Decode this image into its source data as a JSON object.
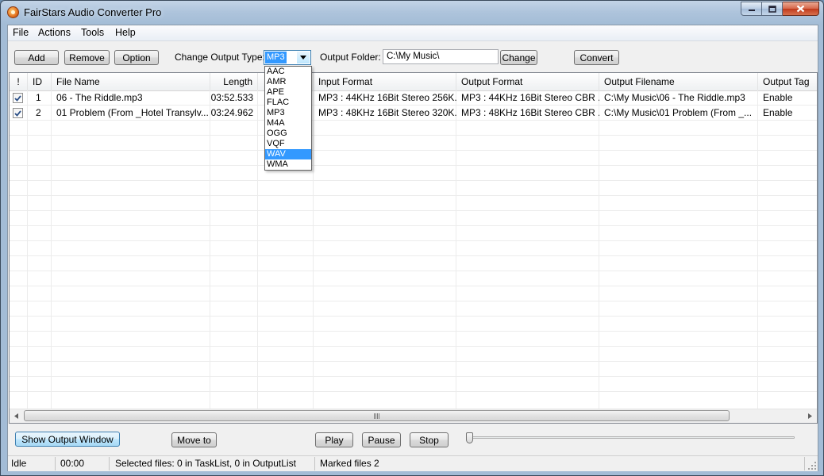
{
  "window": {
    "title": "FairStars Audio Converter Pro"
  },
  "menu": [
    "File",
    "Actions",
    "Tools",
    "Help"
  ],
  "toolbar": {
    "add": "Add",
    "remove": "Remove",
    "option": "Option",
    "output_type_label": "Change Output Type:",
    "output_type_value": "MP3",
    "output_folder_label": "Output Folder:",
    "output_folder_value": "C:\\My Music\\",
    "change": "Change",
    "convert": "Convert"
  },
  "output_type_options": [
    "AAC",
    "AMR",
    "APE",
    "FLAC",
    "MP3",
    "M4A",
    "OGG",
    "VQF",
    "WAV",
    "WMA"
  ],
  "output_type_highlighted": "WAV",
  "table": {
    "columns": [
      "!",
      "ID",
      "File Name",
      "Length",
      "",
      "Input Format",
      "Output Format",
      "Output Filename",
      "Output Tag"
    ],
    "rows": [
      {
        "checked": true,
        "id": "1",
        "file_name": "06 - The Riddle.mp3",
        "length": "03:52.533",
        "size": "",
        "input_format": "MP3 : 44KHz 16Bit Stereo 256K...",
        "output_format": "MP3 : 44KHz 16Bit Stereo CBR ...",
        "output_filename": "C:\\My Music\\06 - The Riddle.mp3",
        "output_tag": "Enable"
      },
      {
        "checked": true,
        "id": "2",
        "file_name": "01 Problem (From _Hotel Transylv...",
        "length": "03:24.962",
        "size": "",
        "input_format": "MP3 : 48KHz 16Bit Stereo 320K...",
        "output_format": "MP3 : 48KHz 16Bit Stereo CBR ...",
        "output_filename": "C:\\My Music\\01 Problem (From _...",
        "output_tag": "Enable"
      }
    ]
  },
  "bottom": {
    "show_output": "Show Output Window",
    "move_to": "Move to",
    "play": "Play",
    "pause": "Pause",
    "stop": "Stop",
    "seek_position": 0
  },
  "status": {
    "state": "Idle",
    "time": "00:00",
    "selected": "Selected files: 0 in TaskList, 0 in OutputList",
    "marked": "Marked files 2"
  }
}
